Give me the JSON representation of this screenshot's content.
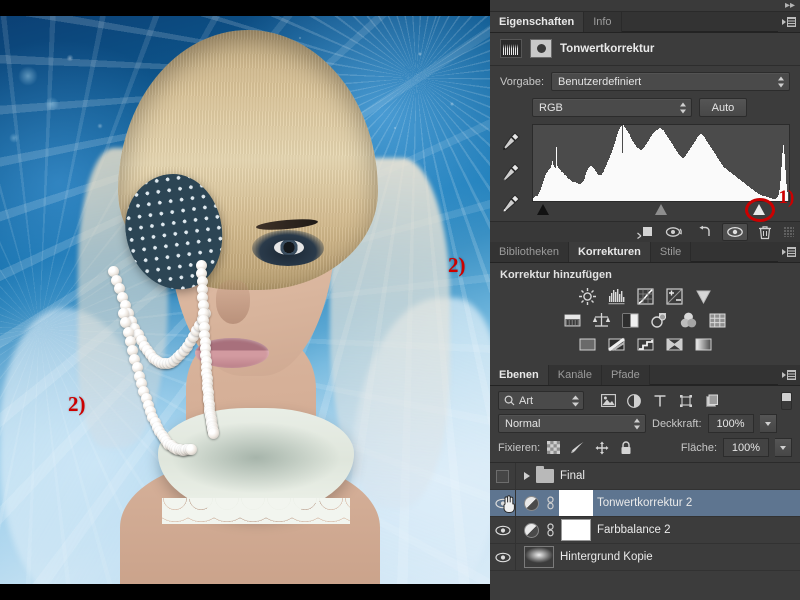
{
  "canvas": {
    "annotations": [
      {
        "name": "annotation-2-right",
        "text": "2)"
      },
      {
        "name": "annotation-2-left",
        "text": "2)"
      },
      {
        "name": "annotation-1",
        "text": "1)"
      }
    ],
    "photo_description": "Blonde fashion model with rhinestone eye patch, pearl strands and lace feather collar on icy blue background"
  },
  "properties_panel": {
    "tabs": [
      {
        "label": "Eigenschaften",
        "active": true
      },
      {
        "label": "Info",
        "active": false
      }
    ],
    "adjustment_title": "Tonwertkorrektur",
    "preset_label": "Vorgabe:",
    "preset_value": "Benutzerdefiniert",
    "channel_value": "RGB",
    "auto_button": "Auto",
    "droppers": [
      "set-black-point-eyedropper",
      "set-gray-point-eyedropper",
      "set-white-point-eyedropper"
    ],
    "footer_buttons": [
      "clip-to-layer-icon",
      "view-previous-state-icon",
      "reset-icon",
      "toggle-layer-visibility-icon",
      "delete-adjustment-layer-icon"
    ],
    "sliders": {
      "black_point": 2,
      "gray_point": 50,
      "white_point": 90
    },
    "histogram": [
      4,
      5,
      6,
      6,
      7,
      9,
      11,
      14,
      18,
      22,
      26,
      30,
      33,
      36,
      38,
      40,
      41,
      43,
      46,
      52,
      47,
      44,
      43,
      70,
      45,
      42,
      41,
      40,
      38,
      37,
      36,
      34,
      33,
      32,
      30,
      29,
      28,
      27,
      26,
      25,
      25,
      24,
      24,
      23,
      23,
      22,
      22,
      22,
      23,
      24,
      26,
      29,
      33,
      37,
      40,
      42,
      44,
      45,
      45,
      44,
      43,
      41,
      39,
      37,
      35,
      34,
      33,
      33,
      34,
      36,
      38,
      41,
      44,
      47,
      50,
      53,
      56,
      59,
      62,
      66,
      70,
      74,
      78,
      82,
      86,
      90,
      93,
      96,
      97,
      62,
      98,
      96,
      94,
      92,
      90,
      88,
      86,
      83,
      80,
      78,
      76,
      74,
      72,
      70,
      69,
      68,
      67,
      66,
      66,
      67,
      68,
      70,
      72,
      74,
      76,
      78,
      80,
      82,
      84,
      86,
      88,
      89,
      90,
      91,
      92,
      93,
      94,
      94,
      93,
      92,
      91,
      89,
      87,
      85,
      83,
      81,
      79,
      77,
      75,
      73,
      71,
      69,
      67,
      65,
      63,
      61,
      59,
      58,
      57,
      56,
      56,
      57,
      58,
      60,
      62,
      64,
      66,
      68,
      70,
      72,
      74,
      76,
      78,
      80,
      82,
      84,
      85,
      86,
      86,
      85,
      84,
      82,
      80,
      78,
      76,
      74,
      72,
      70,
      68,
      66,
      64,
      62,
      60,
      58,
      56,
      54,
      52,
      50,
      48,
      46,
      44,
      43,
      42,
      41,
      40,
      39,
      38,
      37,
      36,
      35,
      34,
      33,
      32,
      31,
      30,
      29,
      28,
      27,
      26,
      25,
      24,
      23,
      22,
      21,
      20,
      19,
      18,
      17,
      16,
      15,
      14,
      13,
      12,
      11,
      10,
      9,
      9,
      8,
      8,
      7,
      7,
      6,
      6,
      5,
      5,
      5,
      4,
      4,
      4,
      3,
      3,
      3,
      3,
      4,
      5,
      8,
      14,
      26,
      44,
      62,
      72,
      60,
      40,
      22,
      12
    ]
  },
  "adjustments_panel": {
    "tabs": [
      {
        "label": "Bibliotheken",
        "active": false
      },
      {
        "label": "Korrekturen",
        "active": true
      },
      {
        "label": "Stile",
        "active": false
      }
    ],
    "title": "Korrektur hinzufügen",
    "rows": [
      [
        "brightness-contrast-icon",
        "levels-icon",
        "curves-icon",
        "exposure-icon",
        "vibrance-icon"
      ],
      [
        "hue-saturation-icon",
        "color-balance-icon",
        "black-white-icon",
        "photo-filter-icon",
        "channel-mixer-icon",
        "color-lookup-icon"
      ],
      [
        "invert-icon",
        "posterize-icon",
        "threshold-icon",
        "selective-color-icon",
        "gradient-map-icon"
      ]
    ]
  },
  "layers_panel": {
    "tabs": [
      {
        "label": "Ebenen",
        "active": true
      },
      {
        "label": "Kanäle",
        "active": false
      },
      {
        "label": "Pfade",
        "active": false
      }
    ],
    "filter_kind": "Art",
    "filter_icons": [
      "filter-pixel-icon",
      "filter-adjustment-icon",
      "filter-type-icon",
      "filter-shape-icon",
      "filter-smart-object-icon"
    ],
    "blend_mode": "Normal",
    "opacity_label": "Deckkraft:",
    "opacity_value": "100%",
    "lock_label": "Fixieren:",
    "lock_icons": [
      "lock-transparency-icon",
      "lock-image-pixels-icon",
      "lock-position-icon",
      "lock-all-icon"
    ],
    "fill_label": "Fläche:",
    "fill_value": "100%",
    "layers": [
      {
        "name": "Final",
        "type": "group",
        "visible": false,
        "selected": false
      },
      {
        "name": "Tonwertkorrektur 2",
        "type": "adjustment",
        "visible": true,
        "selected": true
      },
      {
        "name": "Farbbalance 2",
        "type": "adjustment",
        "visible": true,
        "selected": false
      },
      {
        "name": "Hintergrund Kopie",
        "type": "pixel",
        "visible": true,
        "selected": false
      }
    ]
  },
  "colors": {
    "panel_bg": "#3c3c3c",
    "panel_chrome": "#323232",
    "selection_blue": "#5e7590",
    "annotation_red": "#cc0000",
    "text": "#e4e4e4"
  }
}
